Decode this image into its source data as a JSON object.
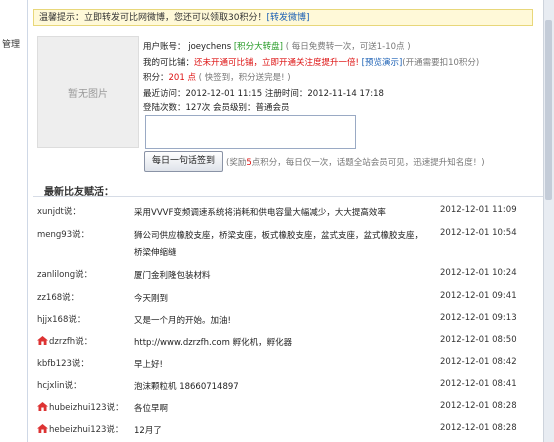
{
  "sidebar": {
    "manage_label": "管理"
  },
  "tip": {
    "text": "温馨提示：立即转发可比网微博，您还可以领取30积分！",
    "link": "[转发微博]"
  },
  "profile": {
    "photo_text": "暂无图片",
    "account_label": "用户账号：",
    "account_value": "joeychens",
    "lottery_link": "[积分大转盘]",
    "lottery_note": "( 每日免费转一次，可送1-10点 )",
    "bind_label": "我的可比铺：",
    "bind_status": "还未开通可比铺",
    "bind_action": "，立即开通关注度提升一倍!",
    "bind_preview": "[预览演示]",
    "bind_note": "(开通需要扣10积分)",
    "points_label": "积分：",
    "points_value": "201 点",
    "points_note": "( 快签到，积分送完是! )",
    "last_visit_label": "最近访问：",
    "last_visit_value": "2012-12-01 11:15",
    "register_label": "注册时间：",
    "register_value": "2012-11-14 17:18",
    "login_count_label": "登陆次数：",
    "login_count_value": "127次",
    "member_level_label": "会员级别：",
    "member_level_value": "普通会员"
  },
  "signin": {
    "button_label": "每日一句话签到",
    "note_prefix": "(奖励",
    "note_red": "5",
    "note_suffix": "点积分，每日仅一次，话题全站会员可见，迅速提升知名度！)"
  },
  "feed": {
    "title": "最新比友赋活：",
    "items": [
      {
        "author": "xunjdt说：",
        "content": "采用VVVF变频调速系统将消耗和供电容量大幅减少，大大提高效率",
        "time": "2012-12-01 11:09",
        "icon": false
      },
      {
        "author": "meng93说：",
        "content": "狮公司供应橡胶支座，桥梁支座，板式橡胶支座，盆式支座，盆式橡胶支座，桥梁伸缩缝",
        "time": "2012-12-01 10:54",
        "icon": false
      },
      {
        "author": "zanlilong说：",
        "content": "厦门金利隆包装材料",
        "time": "2012-12-01 10:24",
        "icon": false
      },
      {
        "author": "zz168说：",
        "content": "今天刚到",
        "time": "2012-12-01 09:41",
        "icon": false
      },
      {
        "author": "hjjx168说：",
        "content": "又是一个月的开始。加油!",
        "time": "2012-12-01 09:13",
        "icon": false
      },
      {
        "author": "dzrzfh说：",
        "content": "http://www.dzrzfh.com 孵化机，孵化器",
        "time": "2012-12-01 08:50",
        "icon": true
      },
      {
        "author": "kbfb123说：",
        "content": "早上好!",
        "time": "2012-12-01 08:42",
        "icon": false
      },
      {
        "author": "hcjxlin说：",
        "content": "泡沫颗粒机 18660714897",
        "time": "2012-12-01 08:41",
        "icon": false
      },
      {
        "author": "hubeizhui123说：",
        "content": "各位早啊",
        "time": "2012-12-01 08:28",
        "icon": true
      },
      {
        "author": "hebeizhui123说：",
        "content": "12月了",
        "time": "2012-12-01 08:28",
        "icon": true
      }
    ]
  },
  "colors": {
    "accent_red": "#d11111",
    "link_blue": "#1a5fb4",
    "link_green": "#229922",
    "tip_bg": "#fff9d8"
  }
}
